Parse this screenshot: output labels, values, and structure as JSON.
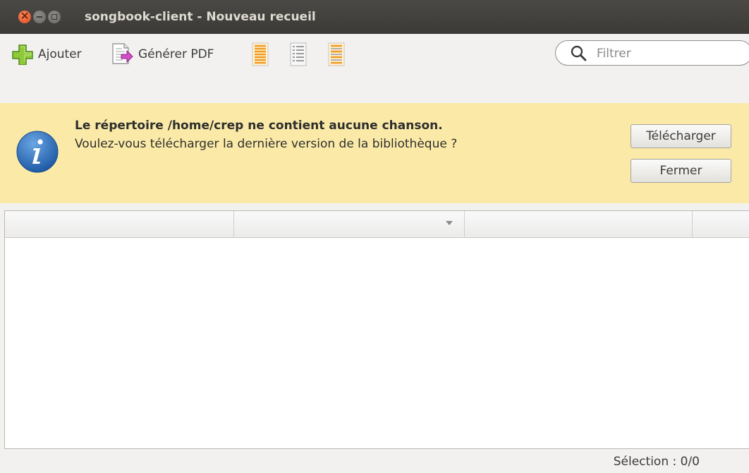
{
  "window": {
    "title": "songbook-client - Nouveau recueil"
  },
  "toolbar": {
    "add_label": "Ajouter",
    "pdf_label": "Générer PDF",
    "filter_placeholder": "Filtrer"
  },
  "icons": {
    "add": "plus-icon",
    "pdf": "document-export-icon",
    "view1": "list-view-icon",
    "view2": "list-view-icon",
    "view3": "list-view-icon",
    "search": "search-icon",
    "info": "info-icon"
  },
  "infobar": {
    "title": "Le répertoire /home/crep ne contient aucune chanson.",
    "message": "Voulez-vous télécharger la dernière version de la bibliothèque ?",
    "download_label": "Télécharger",
    "close_label": "Fermer"
  },
  "table": {
    "headers": [
      "",
      "",
      ""
    ]
  },
  "status": {
    "selection": "Sélection : 0/0"
  },
  "colors": {
    "titlebar": "#3d3c38",
    "window_bg": "#f2f1f0",
    "infobar_bg": "#fbeaa7",
    "close_button": "#e2481d"
  }
}
